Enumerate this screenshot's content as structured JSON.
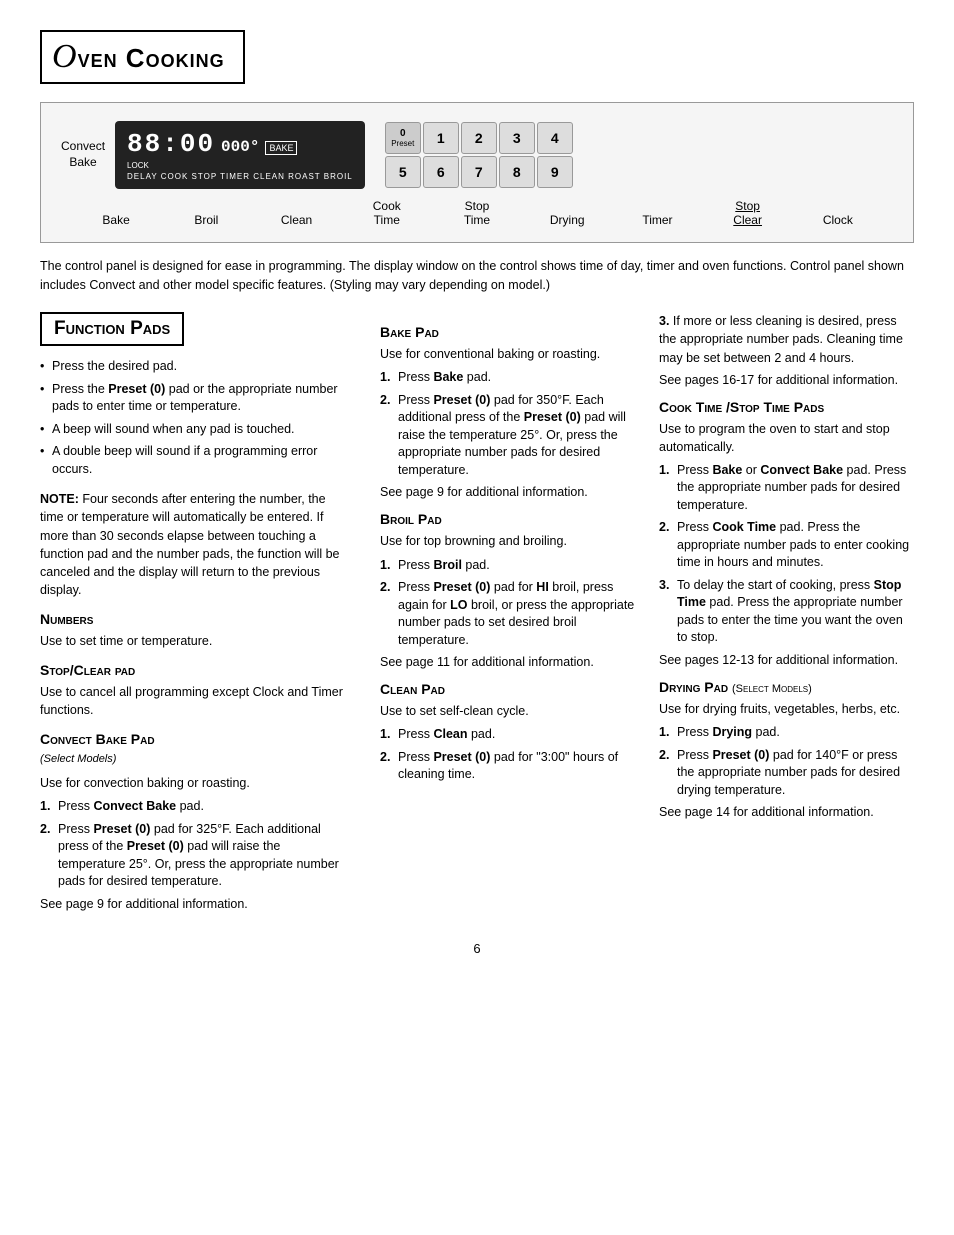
{
  "page": {
    "title_letter": "O",
    "title_text": "ven Cooking",
    "page_number": "6"
  },
  "control_panel": {
    "convect_bake_label": "Convect\nBake",
    "display_time": "88:00",
    "display_deg": "000°",
    "display_bake": "BAKE",
    "display_lock": "LOCK",
    "display_bottom_labels": "DELAY COOK STOP TIMER CLEAN ROAST BROIL",
    "number_keys": [
      {
        "label": "0",
        "sub": "Preset"
      },
      {
        "label": "1"
      },
      {
        "label": "2"
      },
      {
        "label": "3"
      },
      {
        "label": "4"
      },
      {
        "label": "5"
      },
      {
        "label": "6"
      },
      {
        "label": "7"
      },
      {
        "label": "8"
      },
      {
        "label": "9"
      }
    ],
    "pad_labels": [
      {
        "text": "Bake"
      },
      {
        "text": "Broil"
      },
      {
        "text": "Clean"
      },
      {
        "text": "Cook\nTime"
      },
      {
        "text": "Stop\nTime"
      },
      {
        "text": "Drying"
      },
      {
        "text": "Timer"
      },
      {
        "text": "Stop\nClear"
      },
      {
        "text": "Clock"
      }
    ]
  },
  "description": "The control panel is designed for ease in programming. The display window on the control shows time of day, timer and oven functions. Control panel shown includes Convect and other model specific features. (Styling may vary depending on model.)",
  "function_pads": {
    "section_title": "Function Pads",
    "bullets": [
      "Press the desired pad.",
      "Press the Preset (0) pad or the appropriate number pads to enter time or temperature.",
      "A beep will sound when any pad is touched.",
      "A double beep will sound if a programming error occurs."
    ],
    "note": "NOTE: Four seconds after entering the number, the time or temperature will automatically be entered. If more than 30 seconds elapse between touching a function pad and the number pads, the function will be canceled and the display will return to the previous display.",
    "numbers": {
      "heading": "Numbers",
      "text": "Use to set time or temperature."
    },
    "stop_clear": {
      "heading": "Stop/Clear pad",
      "text": "Use to cancel all programming except Clock and Timer functions."
    },
    "convect_bake_pad": {
      "heading": "Convect Bake Pad",
      "sub": "(Select Models)",
      "text": "Use for convection baking or roasting.",
      "steps": [
        "Press Convect Bake pad.",
        "Press Preset (0) pad for 325 F. Each additional press of the Preset (0) pad will raise the temperature 25 . Or, press the appropriate number pads for desired temperature."
      ],
      "see_page": "See page 9 for additional information."
    }
  },
  "bake_pad": {
    "heading": "Bake Pad",
    "text": "Use for conventional baking or roasting.",
    "steps": [
      "Press Bake pad.",
      "Press Preset (0) pad for 350 F. Each additional press of the Preset (0) pad will raise the temperature 25 . Or, press the appropriate number pads for desired temperature."
    ],
    "see_page": "See page 9 for additional information."
  },
  "broil_pad": {
    "heading": "Broil Pad",
    "text": "Use for top browning and broiling.",
    "steps": [
      "Press Broil pad.",
      "Press Preset (0) pad for HI broil, press again for LO broil, or press the appropriate number pads to set desired broil temperature."
    ],
    "see_page": "See page 11 for additional information."
  },
  "clean_pad": {
    "heading": "Clean Pad",
    "text": "Use to set self-clean cycle.",
    "steps": [
      "Press Clean pad.",
      "Press Preset (0) pad for \"3:00\" hours of cleaning time."
    ]
  },
  "third_col": {
    "cleaning_note": "If more or less cleaning is desired, press the appropriate number pads. Cleaning time may be set between 2 and 4 hours.",
    "cleaning_see_page": "See pages 16-17 for additional information.",
    "cook_stop_time": {
      "heading": "Cook Time /Stop Time Pads",
      "text": "Use to program the oven to start and stop automatically.",
      "steps": [
        "Press Bake or Convect Bake pad. Press the appropriate number pads for desired temperature.",
        "Press Cook Time pad.  Press the appropriate number pads to enter cooking time in hours and minutes.",
        "To delay the start of cooking, press Stop Time pad. Press the appropriate number pads to enter the time you want the oven to stop."
      ],
      "see_page": "See pages 12-13 for additional information."
    },
    "drying_pad": {
      "heading": "Drying Pad",
      "sub": "(Select Models)",
      "text": "Use for drying fruits, vegetables, herbs, etc.",
      "steps": [
        "Press Drying pad.",
        "Press Preset (0) pad for 140 F or press the appropriate number pads for desired drying temperature."
      ],
      "see_page": "See page 14 for additional information."
    }
  }
}
